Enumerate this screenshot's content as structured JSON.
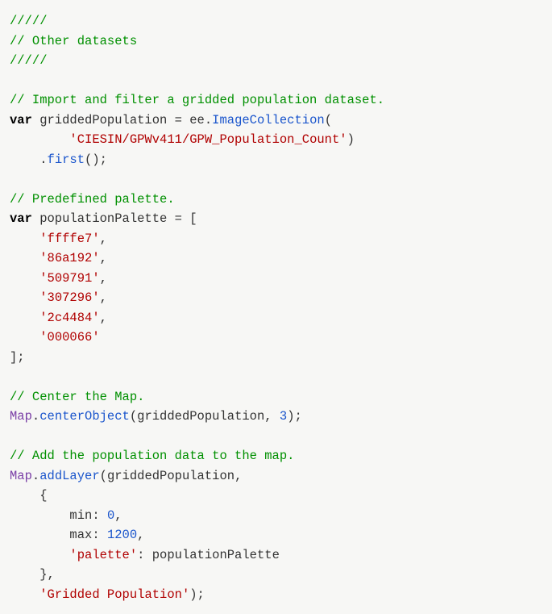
{
  "code": {
    "c1": "/////",
    "c2": "// Other datasets",
    "c3": "/////",
    "c4": "// Import and filter a gridded population dataset.",
    "kw_var1": "var",
    "id_gp": " griddedPopulation ",
    "eq1": "= ",
    "id_ee": "ee",
    "dot1": ".",
    "fn_ic": "ImageCollection",
    "paren_open1": "(",
    "indent2": "        ",
    "str_dataset": "'CIESIN/GPWv411/GPW_Population_Count'",
    "paren_close1": ")",
    "indent1c": "    ",
    "dot2": ".",
    "fn_first": "first",
    "empty_call": "();",
    "c5": "// Predefined palette.",
    "kw_var2": "var",
    "id_pp": " populationPalette ",
    "eq2": "= [",
    "indent1": "    ",
    "p1": "'ffffe7'",
    "p2": "'86a192'",
    "p3": "'509791'",
    "p4": "'307296'",
    "p5": "'2c4484'",
    "p6": "'000066'",
    "comma": ",",
    "arr_close": "];",
    "c6": "// Center the Map.",
    "obj_map1": "Map",
    "dot3": ".",
    "fn_center": "centerObject",
    "center_args_a": "(griddedPopulation, ",
    "num3": "3",
    "center_args_b": ");",
    "c7": "// Add the population data to the map.",
    "obj_map2": "Map",
    "dot4": ".",
    "fn_add": "addLayer",
    "add_open": "(griddedPopulation,",
    "brace_open": "    {",
    "indent3": "        ",
    "min_lbl": "min: ",
    "num0": "0",
    "max_lbl": "max: ",
    "num1200": "1200",
    "pal_key": "'palette'",
    "pal_after": ": populationPalette",
    "brace_close": "    },",
    "str_layer": "'Gridded Population'",
    "tail": ");"
  }
}
